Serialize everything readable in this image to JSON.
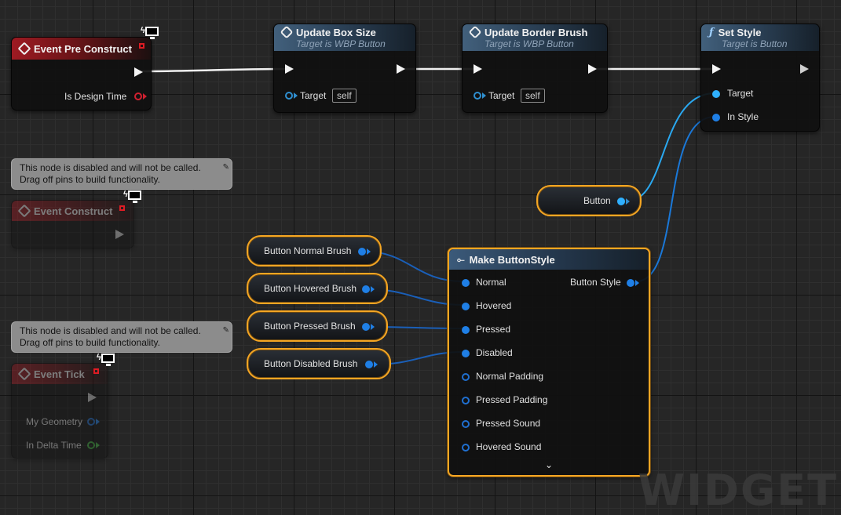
{
  "watermark": "WIDGET",
  "disabled_tooltip": {
    "line1": "This node is disabled and will not be called.",
    "line2": "Drag off pins to build functionality."
  },
  "nodes": {
    "event_pre_construct": {
      "title": "Event Pre Construct",
      "pin_is_design_time": "Is Design Time"
    },
    "event_construct": {
      "title": "Event Construct"
    },
    "event_tick": {
      "title": "Event Tick",
      "pin_my_geometry": "My Geometry",
      "pin_in_delta_time": "In Delta Time"
    },
    "update_box_size": {
      "title": "Update Box Size",
      "subtitle": "Target is WBP Button",
      "pin_target": "Target",
      "target_value": "self"
    },
    "update_border_brush": {
      "title": "Update Border Brush",
      "subtitle": "Target is WBP Button",
      "pin_target": "Target",
      "target_value": "self"
    },
    "set_style": {
      "title": "Set Style",
      "subtitle": "Target is Button",
      "pin_target": "Target",
      "pin_in_style": "In Style"
    },
    "make_button_style": {
      "title": "Make ButtonStyle",
      "output": "Button Style",
      "inputs": [
        "Normal",
        "Hovered",
        "Pressed",
        "Disabled",
        "Normal Padding",
        "Pressed Padding",
        "Pressed Sound",
        "Hovered Sound"
      ]
    }
  },
  "variables": {
    "button": "Button",
    "button_normal_brush": "Button Normal Brush",
    "button_hovered_brush": "Button Hovered Brush",
    "button_pressed_brush": "Button Pressed Brush",
    "button_disabled_brush": "Button Disabled Brush"
  },
  "colors": {
    "exec_wire": "#ffffff",
    "data_wire": "#1a78d8",
    "object_wire": "#2aa8f0",
    "selection": "#f5a623",
    "event_header": "#9e1a22",
    "function_header": "#42607c"
  },
  "icons": {
    "event": "event-diamond-icon",
    "function": "function-f-icon",
    "make_struct": "make-struct-icon",
    "client_server": "monitor-bolt-icon",
    "pin": "pushpin-icon",
    "expand": "chevron-down-icon"
  }
}
